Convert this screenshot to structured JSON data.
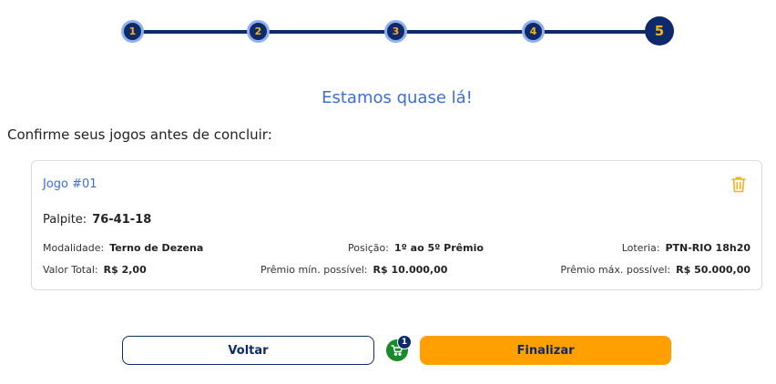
{
  "stepper": {
    "steps": [
      "1",
      "2",
      "3",
      "4",
      "5"
    ],
    "current": 5
  },
  "headline": "Estamos quase lá!",
  "subtitle": "Confirme seus jogos antes de concluir:",
  "games": [
    {
      "title": "Jogo #01",
      "palpite_label": "Palpite:",
      "palpite_value": "76-41-18",
      "modalidade_label": "Modalidade:",
      "modalidade_value": "Terno de Dezena",
      "posicao_label": "Posição:",
      "posicao_value": "1º ao 5º Prêmio",
      "loteria_label": "Loteria:",
      "loteria_value": "PTN-RIO 18h20",
      "valor_label": "Valor Total:",
      "valor_value": "R$ 2,00",
      "premio_min_label": "Prêmio mín. possível:",
      "premio_min_value": "R$ 10.000,00",
      "premio_max_label": "Prêmio máx. possível:",
      "premio_max_value": "R$ 50.000,00"
    }
  ],
  "actions": {
    "back_label": "Voltar",
    "finish_label": "Finalizar",
    "cart_count": "1"
  },
  "colors": {
    "primary": "#0f2a6b",
    "accent_blue": "#3b6fd4",
    "orange": "#ffa000",
    "green": "#1a8a2a",
    "trash": "#f5b020"
  }
}
